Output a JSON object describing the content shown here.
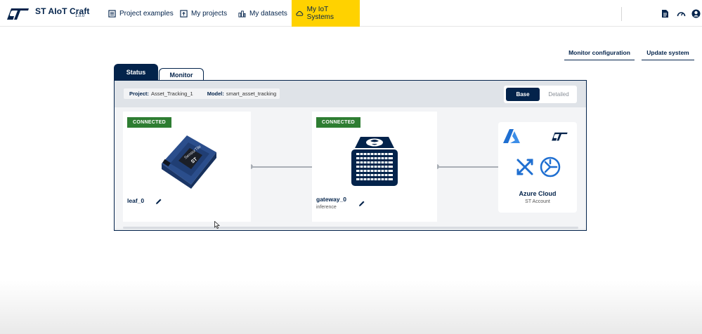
{
  "app": {
    "title": "ST AIoT Craft",
    "version": "1.0.0"
  },
  "nav": {
    "items": [
      {
        "label": "Project examples",
        "icon": "list-icon"
      },
      {
        "label": "My projects",
        "icon": "project-folder-icon"
      },
      {
        "label": "My datasets",
        "icon": "dataset-icon"
      },
      {
        "label": "My IoT Systems",
        "icon": "cloud-icon",
        "active": true
      }
    ]
  },
  "top_icons": [
    "document-icon",
    "dashboard-gauge-icon",
    "user-account-icon"
  ],
  "actions": {
    "monitor_configuration": "Monitor configuration",
    "update_system": "Update system"
  },
  "tabs": {
    "status": "Status",
    "monitor": "Monitor"
  },
  "project": {
    "project_label": "Project:",
    "project_value": "Asset_Tracking_1",
    "model_label": "Model:",
    "model_value": "smart_asset_tracking"
  },
  "view_toggle": {
    "base": "Base",
    "detailed": "Detailed",
    "selected": "Base"
  },
  "nodes": {
    "leaf": {
      "status": "CONNECTED",
      "name": "leaf_0"
    },
    "gateway": {
      "status": "CONNECTED",
      "name": "gateway_0",
      "role": "inference"
    },
    "cloud": {
      "title": "Azure Cloud",
      "subtitle": "ST Account"
    }
  },
  "colors": {
    "brand_navy": "#03234b",
    "accent_yellow": "#ffd200",
    "connected_green": "#2e7d32"
  }
}
